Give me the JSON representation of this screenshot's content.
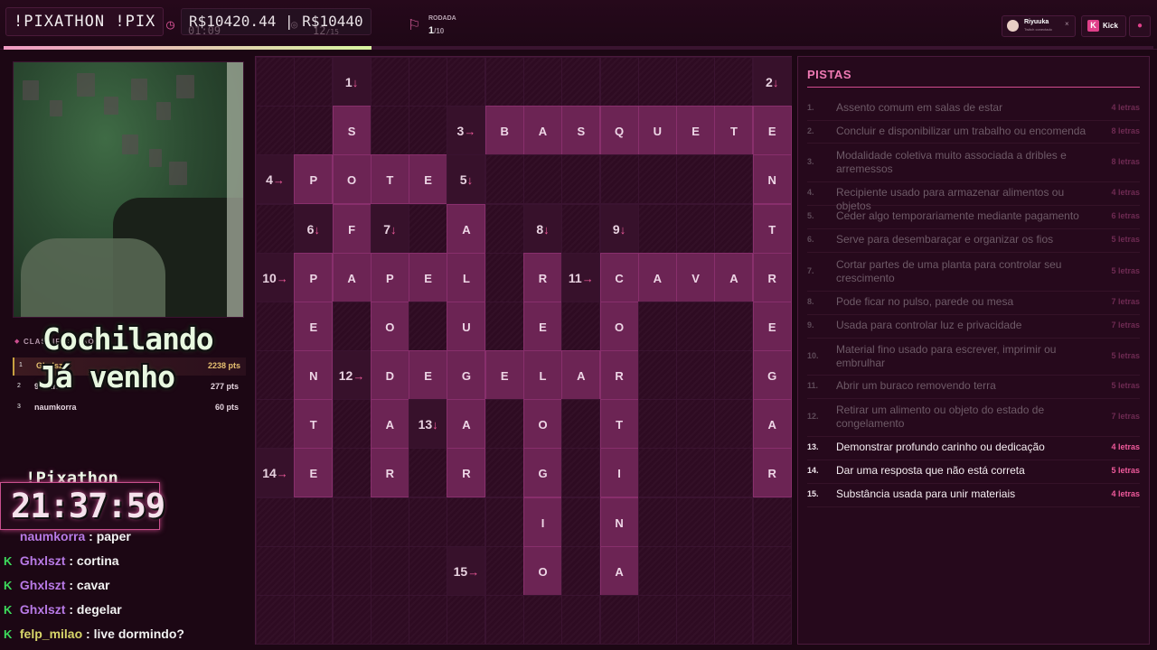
{
  "topbar": {
    "brand": "!PIXATHON !PIX",
    "money": "R$10420.44 | R$10440",
    "timer": "01:09",
    "count": "12",
    "count_total": "/15",
    "round_label": "RODADA",
    "round_value": "1",
    "round_total": "/10",
    "user_name": "Riyuuka",
    "user_sub": "Twitch conectado",
    "kick_label": "Kick",
    "progress_fraction": 0.32
  },
  "leaderboard": {
    "title": "CLASSIFICAÇÃO",
    "rows": [
      {
        "rank": "1",
        "name": "Ghxlszt",
        "pts": "2238 pts"
      },
      {
        "rank": "2",
        "name": "9…Arau…",
        "pts": "277 pts"
      },
      {
        "rank": "3",
        "name": "naumkorra",
        "pts": "60 pts"
      }
    ]
  },
  "overlay": {
    "line1": "Cochilando",
    "line2": "Já venho"
  },
  "pixathon": {
    "label": "!Pixathon",
    "clock": "21:37:59"
  },
  "chat": [
    {
      "user": "naumkorra",
      "msg": ": paper",
      "badge": "",
      "color": "purple"
    },
    {
      "user": "Ghxlszt",
      "msg": ": cortina",
      "badge": "K",
      "color": "purple"
    },
    {
      "user": "Ghxlszt",
      "msg": ": cavar",
      "badge": "K",
      "color": "purple"
    },
    {
      "user": "Ghxlszt",
      "msg": ": degelar",
      "badge": "K",
      "color": "purple"
    },
    {
      "user": "felp_milao",
      "msg": ": live dormindo?",
      "badge": "K",
      "color": "yellow"
    }
  ],
  "grid": {
    "cols": 14,
    "rows": 12,
    "clue_cells": [
      {
        "r": 0,
        "c": 2,
        "label": "1",
        "arrow": "↓"
      },
      {
        "r": 0,
        "c": 13,
        "label": "2",
        "arrow": "↓"
      },
      {
        "r": 1,
        "c": 5,
        "label": "3",
        "arrow": "→"
      },
      {
        "r": 2,
        "c": 0,
        "label": "4",
        "arrow": "→"
      },
      {
        "r": 2,
        "c": 5,
        "label": "5",
        "arrow": "↓"
      },
      {
        "r": 3,
        "c": 1,
        "label": "6",
        "arrow": "↓"
      },
      {
        "r": 3,
        "c": 3,
        "label": "7",
        "arrow": "↓"
      },
      {
        "r": 3,
        "c": 7,
        "label": "8",
        "arrow": "↓"
      },
      {
        "r": 3,
        "c": 9,
        "label": "9",
        "arrow": "↓"
      },
      {
        "r": 4,
        "c": 0,
        "label": "10",
        "arrow": "→"
      },
      {
        "r": 4,
        "c": 8,
        "label": "11",
        "arrow": "→"
      },
      {
        "r": 6,
        "c": 2,
        "label": "12",
        "arrow": "→"
      },
      {
        "r": 7,
        "c": 4,
        "label": "13",
        "arrow": "↓"
      },
      {
        "r": 8,
        "c": 0,
        "label": "14",
        "arrow": "→"
      },
      {
        "r": 10,
        "c": 5,
        "label": "15",
        "arrow": "→"
      }
    ],
    "letter_cells": [
      {
        "r": 1,
        "c": 2,
        "ch": "S"
      },
      {
        "r": 1,
        "c": 6,
        "ch": "B"
      },
      {
        "r": 1,
        "c": 7,
        "ch": "A"
      },
      {
        "r": 1,
        "c": 8,
        "ch": "S"
      },
      {
        "r": 1,
        "c": 9,
        "ch": "Q"
      },
      {
        "r": 1,
        "c": 10,
        "ch": "U"
      },
      {
        "r": 1,
        "c": 11,
        "ch": "E"
      },
      {
        "r": 1,
        "c": 12,
        "ch": "T"
      },
      {
        "r": 1,
        "c": 13,
        "ch": "E"
      },
      {
        "r": 2,
        "c": 1,
        "ch": "P"
      },
      {
        "r": 2,
        "c": 2,
        "ch": "O"
      },
      {
        "r": 2,
        "c": 3,
        "ch": "T"
      },
      {
        "r": 2,
        "c": 4,
        "ch": "E"
      },
      {
        "r": 2,
        "c": 13,
        "ch": "N"
      },
      {
        "r": 3,
        "c": 2,
        "ch": "F"
      },
      {
        "r": 3,
        "c": 5,
        "ch": "A"
      },
      {
        "r": 3,
        "c": 13,
        "ch": "T"
      },
      {
        "r": 4,
        "c": 1,
        "ch": "P"
      },
      {
        "r": 4,
        "c": 2,
        "ch": "A"
      },
      {
        "r": 4,
        "c": 3,
        "ch": "P"
      },
      {
        "r": 4,
        "c": 4,
        "ch": "E"
      },
      {
        "r": 4,
        "c": 5,
        "ch": "L"
      },
      {
        "r": 4,
        "c": 7,
        "ch": "R"
      },
      {
        "r": 4,
        "c": 9,
        "ch": "C"
      },
      {
        "r": 4,
        "c": 10,
        "ch": "A"
      },
      {
        "r": 4,
        "c": 11,
        "ch": "V"
      },
      {
        "r": 4,
        "c": 12,
        "ch": "A"
      },
      {
        "r": 4,
        "c": 13,
        "ch": "R"
      },
      {
        "r": 5,
        "c": 1,
        "ch": "E"
      },
      {
        "r": 5,
        "c": 3,
        "ch": "O"
      },
      {
        "r": 5,
        "c": 5,
        "ch": "U"
      },
      {
        "r": 5,
        "c": 7,
        "ch": "E"
      },
      {
        "r": 5,
        "c": 9,
        "ch": "O"
      },
      {
        "r": 5,
        "c": 13,
        "ch": "E"
      },
      {
        "r": 6,
        "c": 1,
        "ch": "N"
      },
      {
        "r": 6,
        "c": 3,
        "ch": "D"
      },
      {
        "r": 6,
        "c": 4,
        "ch": "E"
      },
      {
        "r": 6,
        "c": 5,
        "ch": "G"
      },
      {
        "r": 6,
        "c": 6,
        "ch": "E"
      },
      {
        "r": 6,
        "c": 7,
        "ch": "L"
      },
      {
        "r": 6,
        "c": 8,
        "ch": "A"
      },
      {
        "r": 6,
        "c": 9,
        "ch": "R"
      },
      {
        "r": 6,
        "c": 13,
        "ch": "G"
      },
      {
        "r": 7,
        "c": 1,
        "ch": "T"
      },
      {
        "r": 7,
        "c": 3,
        "ch": "A"
      },
      {
        "r": 7,
        "c": 5,
        "ch": "A"
      },
      {
        "r": 7,
        "c": 7,
        "ch": "O"
      },
      {
        "r": 7,
        "c": 9,
        "ch": "T"
      },
      {
        "r": 7,
        "c": 13,
        "ch": "A"
      },
      {
        "r": 8,
        "c": 1,
        "ch": "E"
      },
      {
        "r": 8,
        "c": 3,
        "ch": "R"
      },
      {
        "r": 8,
        "c": 5,
        "ch": "R"
      },
      {
        "r": 8,
        "c": 7,
        "ch": "G"
      },
      {
        "r": 8,
        "c": 9,
        "ch": "I"
      },
      {
        "r": 8,
        "c": 13,
        "ch": "R"
      },
      {
        "r": 9,
        "c": 7,
        "ch": "I"
      },
      {
        "r": 9,
        "c": 9,
        "ch": "N"
      },
      {
        "r": 10,
        "c": 7,
        "ch": "O"
      },
      {
        "r": 10,
        "c": 9,
        "ch": "A"
      }
    ]
  },
  "clues": {
    "title": "PISTAS",
    "items": [
      {
        "num": "1.",
        "text": "Assento comum em salas de estar",
        "len": "4 letras",
        "active": false
      },
      {
        "num": "2.",
        "text": "Concluir e disponibilizar um trabalho ou encomenda",
        "len": "8 letras",
        "active": false
      },
      {
        "num": "3.",
        "text": "Modalidade coletiva muito associada a dribles e arremessos",
        "len": "8 letras",
        "active": false
      },
      {
        "num": "4.",
        "text": "Recipiente usado para armazenar alimentos ou objetos",
        "len": "4 letras",
        "active": false
      },
      {
        "num": "5.",
        "text": "Ceder algo temporariamente mediante pagamento",
        "len": "6 letras",
        "active": false
      },
      {
        "num": "6.",
        "text": "Serve para desembaraçar e organizar os fios",
        "len": "5 letras",
        "active": false
      },
      {
        "num": "7.",
        "text": "Cortar partes de uma planta para controlar seu crescimento",
        "len": "5 letras",
        "active": false
      },
      {
        "num": "8.",
        "text": "Pode ficar no pulso, parede ou mesa",
        "len": "7 letras",
        "active": false
      },
      {
        "num": "9.",
        "text": "Usada para controlar luz e privacidade",
        "len": "7 letras",
        "active": false
      },
      {
        "num": "10.",
        "text": "Material fino usado para escrever, imprimir ou embrulhar",
        "len": "5 letras",
        "active": false
      },
      {
        "num": "11.",
        "text": "Abrir um buraco removendo terra",
        "len": "5 letras",
        "active": false
      },
      {
        "num": "12.",
        "text": "Retirar um alimento ou objeto do estado de congelamento",
        "len": "7 letras",
        "active": false
      },
      {
        "num": "13.",
        "text": "Demonstrar profundo carinho ou dedicação",
        "len": "4 letras",
        "active": true
      },
      {
        "num": "14.",
        "text": "Dar uma resposta que não está correta",
        "len": "5 letras",
        "active": true
      },
      {
        "num": "15.",
        "text": "Substância usada para unir materiais",
        "len": "4 letras",
        "active": true
      }
    ]
  }
}
